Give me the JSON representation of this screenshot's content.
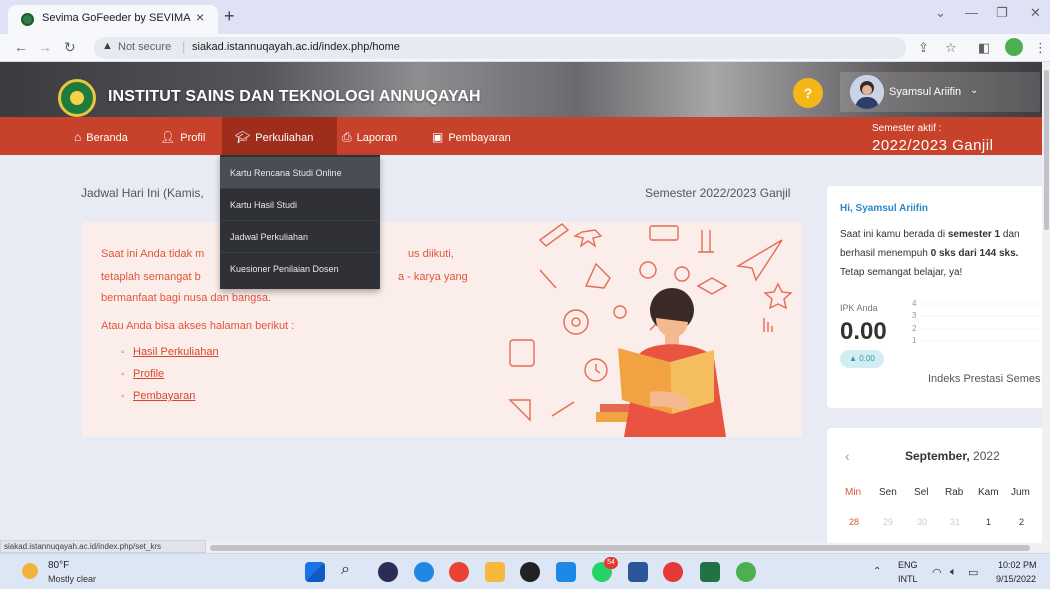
{
  "browser": {
    "tab_title": "Sevima GoFeeder by SEVIMA",
    "tab_close": "×",
    "new_tab": "+",
    "not_secure": "Not secure",
    "url": "siakad.istannuqayah.ac.id/index.php/home",
    "status_url": "siakad.istannuqayah.ac.id/index.php/set_krs"
  },
  "header": {
    "site_title": "INSTITUT SAINS DAN TEKNOLOGI ANNUQAYAH",
    "user_name": "Syamsul Ariifin"
  },
  "nav": {
    "items": [
      {
        "label": "Beranda",
        "icon": "home-icon"
      },
      {
        "label": "Profil",
        "icon": "user-icon"
      },
      {
        "label": "Perkuliahan",
        "icon": "graduation-cap-icon"
      },
      {
        "label": "Laporan",
        "icon": "print-icon"
      },
      {
        "label": "Pembayaran",
        "icon": "money-icon"
      }
    ],
    "semester_label": "Semester aktif :",
    "semester_value": "2022/2023 Ganjil"
  },
  "dropdown": {
    "items": [
      "Kartu Rencana Studi Online",
      "Kartu Hasil Studi",
      "Jadwal Perkuliahan",
      "Kuesioner Penilaian Dosen"
    ]
  },
  "main": {
    "schedule_title": "Jadwal Hari Ini (Kamis,",
    "semester_label": "Semester 2022/2023 Ganjil",
    "info": {
      "line1a": "Saat ini Anda tidak m",
      "line1b": "us diikuti,",
      "line2a": "tetaplah semangat b",
      "line2b": "a - karya yang",
      "line3": "bermanfaat bagi nusa dan bangsa.",
      "akses": "Atau Anda bisa akses halaman berikut :",
      "links": [
        "Hasil Perkuliahan",
        "Profile",
        "Pembayaran"
      ]
    }
  },
  "greeting": {
    "title": "Hi, Syamsul Ariifin",
    "line1": "Saat ini kamu berada di",
    "line1_bold": "semester 1",
    "line1_end": "dan",
    "line2": "berhasil menempuh",
    "line2_bold": "0 sks dari 144 sks.",
    "line3": "Tetap semangat belajar, ya!",
    "ipk_label": "IPK Anda",
    "ipk_value": "0.00",
    "ipk_badge": "▲ 0.00",
    "chart_title": "Indeks Prestasi Semes",
    "yticks": [
      "4",
      "3",
      "2",
      "1"
    ]
  },
  "calendar": {
    "prev": "‹",
    "month": "September,",
    "year": "2022",
    "days": [
      "Min",
      "Sen",
      "Sel",
      "Rab",
      "Kam",
      "Jum"
    ],
    "dates": [
      "28",
      "29",
      "30",
      "31",
      "1",
      "2"
    ]
  },
  "taskbar": {
    "temp": "80°F",
    "weather": "Mostly clear",
    "lang1": "ENG",
    "lang2": "INTL",
    "time": "10:02 PM",
    "date": "9/15/2022",
    "badge": "54"
  }
}
